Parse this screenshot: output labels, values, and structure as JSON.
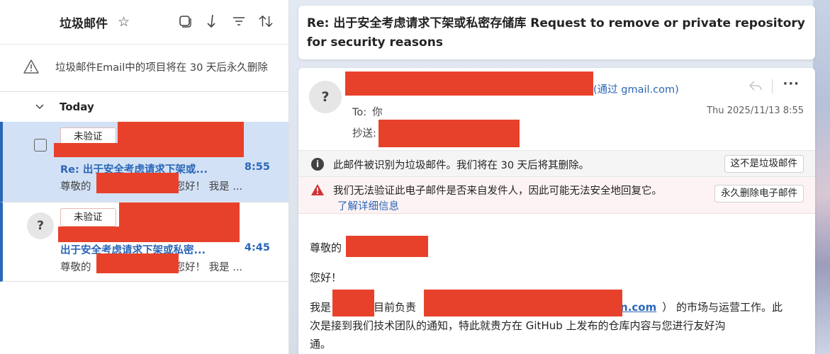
{
  "list": {
    "title": "垃圾邮件",
    "notice": "垃圾邮件Email中的项目将在 30 天后永久删除",
    "group": "Today",
    "messages": [
      {
        "badge": "未验证",
        "subject": "Re: 出于安全考虑请求下架或...",
        "time": "8:55",
        "preview_start": "尊敬的",
        "preview_end": "您好！ 我是 ..."
      },
      {
        "badge": "未验证",
        "avatar": "?",
        "subject": "出于安全考虑请求下架或私密...",
        "time": "4:45",
        "preview_start": "尊敬的",
        "preview_end": "您好！ 我是 ..."
      }
    ]
  },
  "reading": {
    "subject": "Re: 出于安全考虑请求下架或私密存储库 Request to remove or private repository for security reasons",
    "avatar": "?",
    "via": "(通过 gmail.com)",
    "to_label": "To:",
    "to_value": "你",
    "cc_label": "抄送:",
    "date": "Thu 2025/11/13 8:55",
    "more": "···",
    "junk_notice": "此邮件被识别为垃圾邮件。我们将在 30 天后将其删除。",
    "not_junk_button": "这不是垃圾邮件",
    "verify_warning": "我们无法验证此电子邮件是否来自发件人，因此可能无法安全地回复它。",
    "learn_more": "了解详细信息",
    "delete_button": "永久删除电子邮件",
    "greeting": "尊敬的",
    "hello": "您好！",
    "intro_start": "我是",
    "intro_mid": "目前负责",
    "intro_link": "n.com",
    "intro_end": "） 的市场与运营工作。此",
    "line2": "次是接到我们技术团队的通知，特此就贵方在 GitHub 上发布的仓库内容与您进行友好沟",
    "line3": "通。"
  },
  "colors": {
    "accent": "#2b67b8",
    "redaction": "#e8412b",
    "selected_bg": "#d2e1f5",
    "warning": "#d13438"
  }
}
